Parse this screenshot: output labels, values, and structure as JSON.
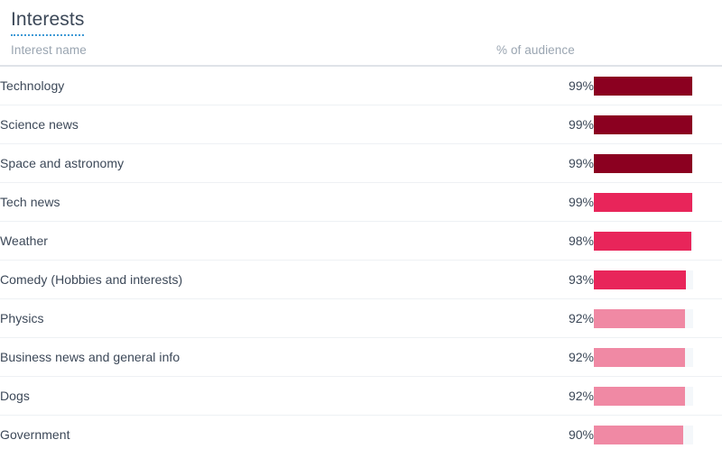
{
  "panel": {
    "title": "Interests",
    "title_underline_color": "#3f9ad6"
  },
  "table": {
    "headers": {
      "name": "Interest name",
      "percent": "% of audience"
    },
    "rows": [
      {
        "name": "Technology",
        "percent_label": "99%",
        "percent": 99,
        "color": "#8b0020"
      },
      {
        "name": "Science news",
        "percent_label": "99%",
        "percent": 99,
        "color": "#8b0020"
      },
      {
        "name": "Space and astronomy",
        "percent_label": "99%",
        "percent": 99,
        "color": "#8b0020"
      },
      {
        "name": "Tech news",
        "percent_label": "99%",
        "percent": 99,
        "color": "#e8255a"
      },
      {
        "name": "Weather",
        "percent_label": "98%",
        "percent": 98,
        "color": "#e8255a"
      },
      {
        "name": "Comedy (Hobbies and interests)",
        "percent_label": "93%",
        "percent": 93,
        "color": "#e8255a"
      },
      {
        "name": "Physics",
        "percent_label": "92%",
        "percent": 92,
        "color": "#f089a4"
      },
      {
        "name": "Business news and general info",
        "percent_label": "92%",
        "percent": 92,
        "color": "#f089a4"
      },
      {
        "name": "Dogs",
        "percent_label": "92%",
        "percent": 92,
        "color": "#f089a4"
      },
      {
        "name": "Government",
        "percent_label": "90%",
        "percent": 90,
        "color": "#f089a4"
      }
    ]
  },
  "chart_data": {
    "type": "bar",
    "title": "Interests",
    "xlabel": "% of audience",
    "ylabel": "Interest name",
    "categories": [
      "Technology",
      "Science news",
      "Space and astronomy",
      "Tech news",
      "Weather",
      "Comedy (Hobbies and interests)",
      "Physics",
      "Business news and general info",
      "Dogs",
      "Government"
    ],
    "values": [
      99,
      99,
      99,
      99,
      98,
      93,
      92,
      92,
      92,
      90
    ],
    "value_labels": [
      "99%",
      "99%",
      "99%",
      "99%",
      "98%",
      "93%",
      "92%",
      "92%",
      "92%",
      "90%"
    ],
    "colors": [
      "#8b0020",
      "#8b0020",
      "#8b0020",
      "#e8255a",
      "#e8255a",
      "#e8255a",
      "#f089a4",
      "#f089a4",
      "#f089a4",
      "#f089a4"
    ],
    "track_color": "#f4f7fa",
    "xlim": [
      0,
      100
    ],
    "orientation": "horizontal",
    "grid": false,
    "legend": false
  }
}
